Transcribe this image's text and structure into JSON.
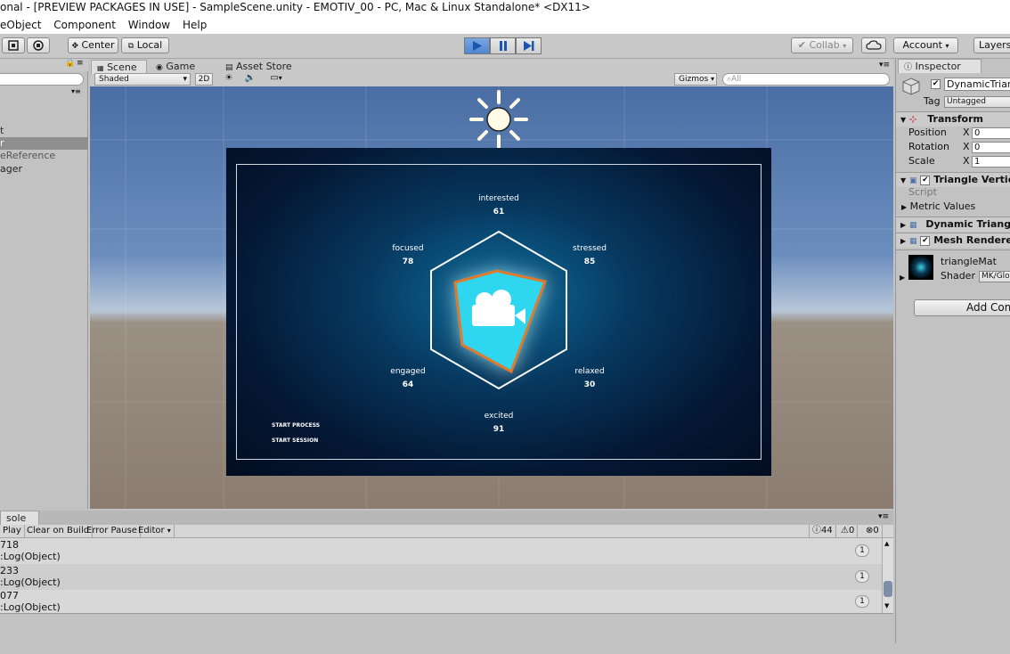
{
  "window": {
    "title": "onal - [PREVIEW PACKAGES IN USE] - SampleScene.unity - EMOTIV_00 - PC, Mac & Linux Standalone* <DX11>"
  },
  "menu": [
    "eObject",
    "Component",
    "Window",
    "Help"
  ],
  "toolbar": {
    "center_label": "Center",
    "local_label": "Local",
    "collab_label": "Collab",
    "account_label": "Account",
    "layers_label": "Layers"
  },
  "hierarchy": {
    "items": [
      {
        "label": "t",
        "selected": false
      },
      {
        "label": "r",
        "selected": true
      },
      {
        "label": "eReference",
        "selected": false
      },
      {
        "label": "ager",
        "selected": false
      }
    ]
  },
  "scene": {
    "tabs": [
      "Scene",
      "Game",
      "Asset Store"
    ],
    "shading_mode": "Shaded",
    "mode_2d": "2D",
    "gizmos_label": "Gizmos",
    "search_placeholder": "All"
  },
  "game": {
    "metrics": [
      {
        "name": "interested",
        "value": "61"
      },
      {
        "name": "stressed",
        "value": "85"
      },
      {
        "name": "relaxed",
        "value": "30"
      },
      {
        "name": "excited",
        "value": "91"
      },
      {
        "name": "engaged",
        "value": "64"
      },
      {
        "name": "focused",
        "value": "78"
      }
    ],
    "buttons": {
      "start_process": "START PROCESS",
      "start_session": "START SESSION"
    },
    "colors": {
      "glow": "#2fd6f0",
      "outline": "#e07a2a",
      "hexagon": "#ffffff"
    }
  },
  "inspector": {
    "tab_label": "Inspector",
    "object_name": "DynamicTriang",
    "tag_label": "Tag",
    "tag_value": "Untagged",
    "transform": {
      "title": "Transform",
      "position_label": "Position",
      "rotation_label": "Rotation",
      "scale_label": "Scale",
      "axis_x": "X",
      "position_x": "0",
      "rotation_x": "0",
      "scale_x": "1"
    },
    "components": {
      "triangle_vertices": "Triangle Vertice",
      "script_label": "Script",
      "metric_values": "Metric Values",
      "dynamic_triangle": "Dynamic Triang",
      "mesh_renderer": "Mesh Renderer"
    },
    "material": {
      "name": "triangleMat",
      "shader_label": "Shader",
      "shader_value": "MK/Glo"
    },
    "add_component": "Add Com"
  },
  "console": {
    "tab_label": "sole",
    "toolbar": {
      "play": "Play",
      "clear_on_build": "Clear on Build",
      "error_pause": "Error Pause",
      "editor": "Editor"
    },
    "counts": {
      "log": "44",
      "warn": "0",
      "error": "0"
    },
    "entries": [
      {
        "line1": "718",
        "line2": ":Log(Object)",
        "count": "1"
      },
      {
        "line1": "233",
        "line2": ":Log(Object)",
        "count": "1"
      },
      {
        "line1": "077",
        "line2": ":Log(Object)",
        "count": "1"
      }
    ]
  }
}
